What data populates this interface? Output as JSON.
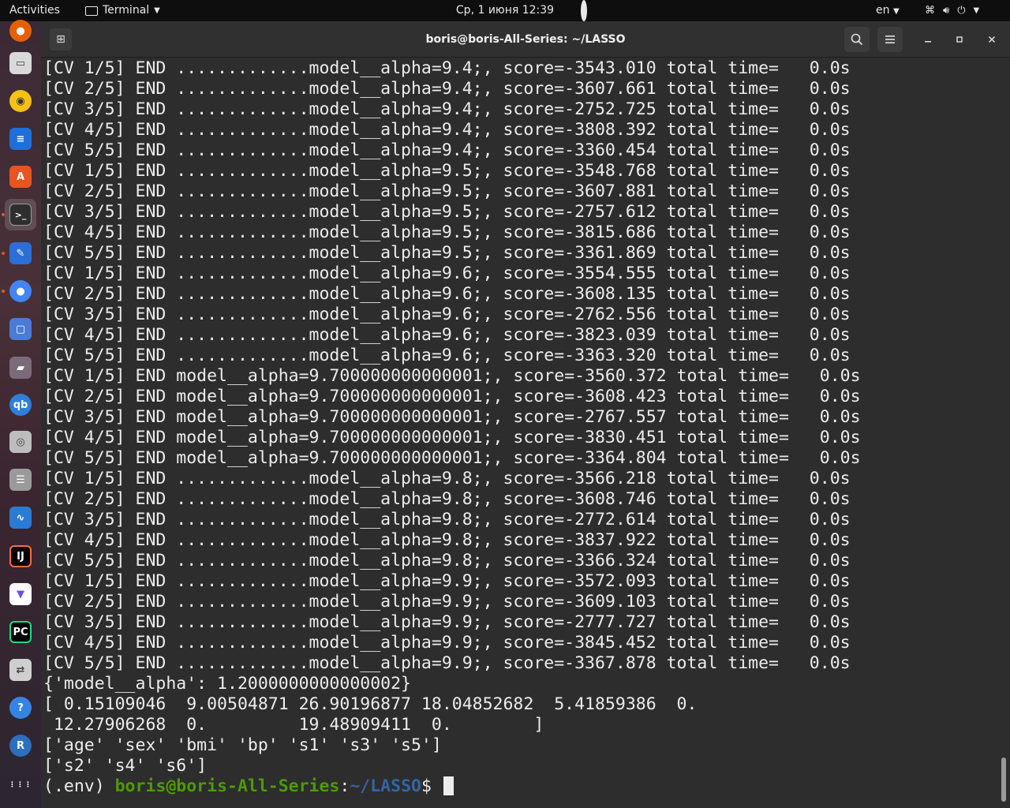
{
  "topbar": {
    "activities": "Activities",
    "app_menu": "Terminal",
    "clock": "Ср, 1 июня  12:39",
    "language": "en"
  },
  "window": {
    "title": "boris@boris-All-Series: ~/LASSO"
  },
  "dock": {
    "items": [
      {
        "name": "firefox-icon",
        "color": "#e66000"
      },
      {
        "name": "files-icon",
        "color": "#d9d9d9"
      },
      {
        "name": "rhythmbox-icon",
        "color": "#f5c211"
      },
      {
        "name": "writer-icon",
        "color": "#1e6fd9"
      },
      {
        "name": "software-icon",
        "color": "#e95420"
      },
      {
        "name": "terminal-icon",
        "color": "#2e2e2e"
      },
      {
        "name": "text-editor-icon",
        "color": "#2a6fd6"
      },
      {
        "name": "chrome-icon",
        "color": "#4285f4"
      },
      {
        "name": "screenshot-icon",
        "color": "#4a7bd6"
      },
      {
        "name": "app-icon",
        "color": "#7a6a7a"
      },
      {
        "name": "qbittorrent-icon",
        "color": "#2f7fd8"
      },
      {
        "name": "disc-icon",
        "color": "#bdbdbd"
      },
      {
        "name": "database-icon",
        "color": "#9a9a9a"
      },
      {
        "name": "system-monitor-icon",
        "color": "#2a7bd4"
      },
      {
        "name": "intellij-icon",
        "color": "#000000"
      },
      {
        "name": "proton-vpn-icon",
        "color": "#ffffff"
      },
      {
        "name": "pycharm-icon",
        "color": "#21d789"
      },
      {
        "name": "settings-toggle-icon",
        "color": "#cfcfcf"
      },
      {
        "name": "help-icon",
        "color": "#3584e4"
      },
      {
        "name": "r-icon",
        "color": "#2c6ec0"
      },
      {
        "name": "show-apps-icon",
        "color": "#ffffff"
      }
    ]
  },
  "terminal": {
    "lines": [
      "[CV 1/5] END .............model__alpha=9.4;, score=-3543.010 total time=   0.0s",
      "[CV 2/5] END .............model__alpha=9.4;, score=-3607.661 total time=   0.0s",
      "[CV 3/5] END .............model__alpha=9.4;, score=-2752.725 total time=   0.0s",
      "[CV 4/5] END .............model__alpha=9.4;, score=-3808.392 total time=   0.0s",
      "[CV 5/5] END .............model__alpha=9.4;, score=-3360.454 total time=   0.0s",
      "[CV 1/5] END .............model__alpha=9.5;, score=-3548.768 total time=   0.0s",
      "[CV 2/5] END .............model__alpha=9.5;, score=-3607.881 total time=   0.0s",
      "[CV 3/5] END .............model__alpha=9.5;, score=-2757.612 total time=   0.0s",
      "[CV 4/5] END .............model__alpha=9.5;, score=-3815.686 total time=   0.0s",
      "[CV 5/5] END .............model__alpha=9.5;, score=-3361.869 total time=   0.0s",
      "[CV 1/5] END .............model__alpha=9.6;, score=-3554.555 total time=   0.0s",
      "[CV 2/5] END .............model__alpha=9.6;, score=-3608.135 total time=   0.0s",
      "[CV 3/5] END .............model__alpha=9.6;, score=-2762.556 total time=   0.0s",
      "[CV 4/5] END .............model__alpha=9.6;, score=-3823.039 total time=   0.0s",
      "[CV 5/5] END .............model__alpha=9.6;, score=-3363.320 total time=   0.0s",
      "[CV 1/5] END model__alpha=9.700000000000001;, score=-3560.372 total time=   0.0s",
      "[CV 2/5] END model__alpha=9.700000000000001;, score=-3608.423 total time=   0.0s",
      "[CV 3/5] END model__alpha=9.700000000000001;, score=-2767.557 total time=   0.0s",
      "[CV 4/5] END model__alpha=9.700000000000001;, score=-3830.451 total time=   0.0s",
      "[CV 5/5] END model__alpha=9.700000000000001;, score=-3364.804 total time=   0.0s",
      "[CV 1/5] END .............model__alpha=9.8;, score=-3566.218 total time=   0.0s",
      "[CV 2/5] END .............model__alpha=9.8;, score=-3608.746 total time=   0.0s",
      "[CV 3/5] END .............model__alpha=9.8;, score=-2772.614 total time=   0.0s",
      "[CV 4/5] END .............model__alpha=9.8;, score=-3837.922 total time=   0.0s",
      "[CV 5/5] END .............model__alpha=9.8;, score=-3366.324 total time=   0.0s",
      "[CV 1/5] END .............model__alpha=9.9;, score=-3572.093 total time=   0.0s",
      "[CV 2/5] END .............model__alpha=9.9;, score=-3609.103 total time=   0.0s",
      "[CV 3/5] END .............model__alpha=9.9;, score=-2777.727 total time=   0.0s",
      "[CV 4/5] END .............model__alpha=9.9;, score=-3845.452 total time=   0.0s",
      "[CV 5/5] END .............model__alpha=9.9;, score=-3367.878 total time=   0.0s",
      "{'model__alpha': 1.2000000000000002}",
      "[ 0.15109046  9.00504871 26.90196877 18.04852682  5.41859386  0.",
      " 12.27906268  0.         19.48909411  0.        ]",
      "['age' 'sex' 'bmi' 'bp' 's1' 's3' 's5']",
      "['s2' 's4' 's6']"
    ],
    "prompt": {
      "env": "(.env) ",
      "user_host": "boris@boris-All-Series",
      "colon": ":",
      "path": "~/LASSO",
      "symbol": "$ "
    }
  }
}
